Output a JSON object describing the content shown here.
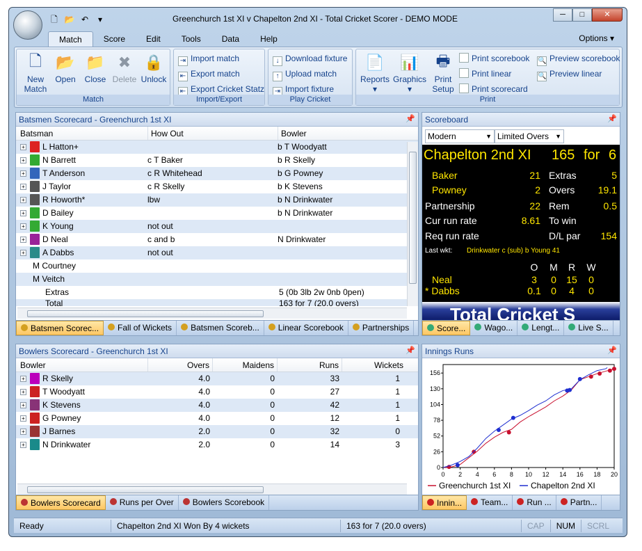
{
  "app": {
    "title": "Greenchurch 1st XI v Chapelton 2nd XI - Total Cricket Scorer - DEMO MODE",
    "options": "Options"
  },
  "tabs": [
    "Match",
    "Score",
    "Edit",
    "Tools",
    "Data",
    "Help"
  ],
  "ribbon": {
    "match": {
      "label": "Match",
      "new": "New",
      "new2": "Match",
      "open": "Open",
      "close": "Close",
      "delete": "Delete",
      "unlock": "Unlock"
    },
    "importexport": {
      "label": "Import/Export",
      "import": "Import match",
      "export": "Export match",
      "statz": "Export Cricket Statz"
    },
    "play": {
      "label": "Play Cricket",
      "download": "Download fixture",
      "upload": "Upload match",
      "importfix": "Import fixture"
    },
    "print": {
      "label": "Print",
      "reports": "Reports",
      "graphics": "Graphics",
      "print": "Print",
      "setup": "Setup",
      "printscore": "Print scorebook",
      "printlinear": "Print linear",
      "printscorecard": "Print scorecard",
      "previewscore": "Preview scorebook",
      "previewlinear": "Preview linear"
    }
  },
  "batsmen": {
    "title": "Batsmen Scorecard - Greenchurch 1st XI",
    "cols": [
      "Batsman",
      "How Out",
      "Bowler"
    ],
    "rows": [
      {
        "name": "L Hatton+",
        "how": "",
        "bowler": "b T Woodyatt",
        "color": "#d22"
      },
      {
        "name": "N Barrett",
        "how": "c T Baker",
        "bowler": "b R Skelly",
        "color": "#3a3"
      },
      {
        "name": "T Anderson",
        "how": "c R Whitehead",
        "bowler": "b G Powney",
        "color": "#36b"
      },
      {
        "name": "J Taylor",
        "how": "c R Skelly",
        "bowler": "b K Stevens",
        "color": "#555"
      },
      {
        "name": "R Howorth*",
        "how": "lbw",
        "bowler": "b N Drinkwater",
        "color": "#555"
      },
      {
        "name": "D Bailey",
        "how": "",
        "bowler": "b N Drinkwater",
        "color": "#3a3"
      },
      {
        "name": "K Young",
        "how": "not out",
        "bowler": "",
        "color": "#3a3"
      },
      {
        "name": "D Neal",
        "how": "c and b",
        "bowler": "N Drinkwater",
        "color": "#929"
      },
      {
        "name": "A Dabbs",
        "how": "not out",
        "bowler": "",
        "color": "#2a8a8a"
      },
      {
        "name": "M Courtney",
        "how": "",
        "bowler": "",
        "color": ""
      },
      {
        "name": "M Veitch",
        "how": "",
        "bowler": "",
        "color": ""
      }
    ],
    "extras_label": "Extras",
    "extras": "5 (0b 3lb 2w 0nb 0pen)",
    "total_label": "Total",
    "total": "163 for 7 (20.0 overs)",
    "tabs": [
      "Batsmen Scorec...",
      "Fall of Wickets",
      "Batsmen Scoreb...",
      "Linear Scorebook",
      "Partnerships"
    ]
  },
  "bowlers": {
    "title": "Bowlers Scorecard - Greenchurch 1st XI",
    "cols": [
      "Bowler",
      "Overs",
      "Maidens",
      "Runs",
      "Wickets"
    ],
    "rows": [
      {
        "name": "R Skelly",
        "overs": "4.0",
        "maidens": "0",
        "runs": "33",
        "wickets": "1",
        "color": "#b0b"
      },
      {
        "name": "T Woodyatt",
        "overs": "4.0",
        "maidens": "0",
        "runs": "27",
        "wickets": "1",
        "color": "#c22"
      },
      {
        "name": "K Stevens",
        "overs": "4.0",
        "maidens": "0",
        "runs": "42",
        "wickets": "1",
        "color": "#837"
      },
      {
        "name": "G Powney",
        "overs": "4.0",
        "maidens": "0",
        "runs": "12",
        "wickets": "1",
        "color": "#c22"
      },
      {
        "name": "J Barnes",
        "overs": "2.0",
        "maidens": "0",
        "runs": "32",
        "wickets": "0",
        "color": "#933"
      },
      {
        "name": "N Drinkwater",
        "overs": "2.0",
        "maidens": "0",
        "runs": "14",
        "wickets": "3",
        "color": "#1a8a8a"
      }
    ],
    "tabs": [
      "Bowlers Scorecard",
      "Runs per Over",
      "Bowlers Scorebook"
    ]
  },
  "scoreboard": {
    "title": "Scoreboard",
    "style": "Modern",
    "format": "Limited Overs",
    "team": "Chapelton 2nd XI",
    "score": "165",
    "for": "for",
    "wkts": "6",
    "bat1": "Baker",
    "bat1r": "21",
    "bat2": "Powney",
    "bat2r": "2",
    "extras_l": "Extras",
    "extras": "5",
    "overs_l": "Overs",
    "overs": "19.1",
    "part_l": "Partnership",
    "part": "22",
    "rem_l": "Rem",
    "rem": "0.5",
    "crr_l": "Cur run rate",
    "crr": "8.61",
    "towin_l": "To win",
    "rrr_l": "Req run rate",
    "dl_l": "D/L par",
    "dl": "154",
    "lastwkt_l": "Last wkt:",
    "lastwkt": "Drinkwater c (sub) b Young 41",
    "bcols": [
      "O",
      "M",
      "R",
      "W"
    ],
    "bowl1": {
      "name": "Neal",
      "o": "3",
      "m": "0",
      "r": "15",
      "w": "0"
    },
    "bowl2": {
      "name": "* Dabbs",
      "o": "0.1",
      "m": "0",
      "r": "4",
      "w": "0"
    },
    "banner": "Total Cricket S",
    "tabs": [
      "Score...",
      "Wago...",
      "Lengt...",
      "Live S..."
    ]
  },
  "innings": {
    "title": "Innings Runs",
    "tabs": [
      "Innin...",
      "Team...",
      "Run ...",
      "Partn..."
    ]
  },
  "chart_data": {
    "type": "line",
    "xlim": [
      0,
      20
    ],
    "ylim": [
      0,
      170
    ],
    "xticks": [
      0,
      2,
      4,
      6,
      8,
      10,
      12,
      14,
      16,
      18,
      20
    ],
    "yticks": [
      0,
      26,
      52,
      78,
      104,
      130,
      156
    ],
    "series": [
      {
        "name": "Greenchurch 1st XI",
        "color": "#c8102e",
        "x": [
          0,
          1,
          2,
          3,
          4,
          5,
          6,
          7,
          8,
          9,
          10,
          11,
          12,
          13,
          14,
          15,
          16,
          17,
          18,
          19,
          20
        ],
        "y": [
          0,
          1,
          5,
          16,
          27,
          40,
          50,
          58,
          63,
          75,
          84,
          92,
          100,
          110,
          118,
          128,
          145,
          150,
          155,
          159,
          163
        ],
        "wickets_x": [
          0.7,
          3.6,
          7.7,
          17.3,
          18.3,
          19.5,
          20
        ],
        "wickets_y": [
          1,
          26,
          58,
          150,
          155,
          160,
          163
        ]
      },
      {
        "name": "Chapelton 2nd XI",
        "color": "#1f2fd0",
        "x": [
          0,
          1,
          2,
          3,
          4,
          5,
          6,
          7,
          8,
          9,
          10,
          11,
          12,
          13,
          14,
          15,
          16,
          17,
          18,
          19,
          19.2
        ],
        "y": [
          0,
          4,
          10,
          18,
          32,
          48,
          60,
          70,
          80,
          86,
          94,
          103,
          110,
          120,
          127,
          130,
          145,
          153,
          160,
          163,
          165
        ],
        "wickets_x": [
          1.7,
          6.5,
          8.2,
          14.5,
          14.8,
          16.0
        ],
        "wickets_y": [
          4,
          62,
          82,
          127,
          128,
          146
        ]
      }
    ]
  },
  "status": {
    "ready": "Ready",
    "result": "Chapelton 2nd XI Won By 4 wickets",
    "score": "163 for 7 (20.0 overs)",
    "cap": "CAP",
    "num": "NUM",
    "scrl": "SCRL"
  }
}
